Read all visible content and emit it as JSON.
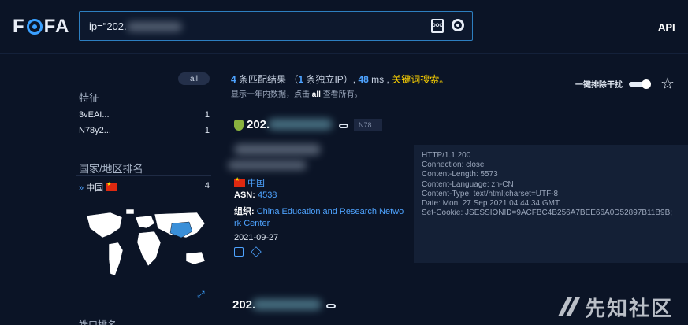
{
  "header": {
    "logo": "FOFA",
    "search_value": "ip=\"202.",
    "api_label": "API"
  },
  "sidebar": {
    "all_label": "all",
    "feature_title": "特征",
    "features": [
      {
        "label": "3vEAI...",
        "count": "1"
      },
      {
        "label": "N78y2...",
        "count": "1"
      }
    ],
    "country_title": "国家/地区排名",
    "countries": [
      {
        "label": "中国",
        "count": "4"
      }
    ],
    "bottom_title": "端口排名"
  },
  "results": {
    "count": "4",
    "count_suffix": "条匹配结果",
    "unique_prefix": "（",
    "unique_count": "1",
    "unique_suffix": "条独立IP）,",
    "time": "48",
    "time_unit": "ms ,",
    "keyword_search": "关键词搜索。",
    "sub_prefix": "显示一年内数据，点击",
    "sub_all": "all",
    "sub_suffix": "查看所有。",
    "toggle_label": "一键排除干扰",
    "items": [
      {
        "ip": "202.",
        "tag": "N78...",
        "country": "中国",
        "asn_label": "ASN:",
        "asn": "4538",
        "org_label": "组织:",
        "org_line1": "China Education and Research Netwo",
        "org_line2": "rk Center",
        "date": "2021-09-27",
        "http": [
          "HTTP/1.1 200",
          "Connection: close",
          "Content-Length: 5573",
          "Content-Language: zh-CN",
          "Content-Type: text/html;charset=UTF-8",
          "Date: Mon, 27 Sep 2021 04:44:34 GMT",
          "Set-Cookie: JSESSIONID=9ACFBC4B256A7BEE66A0D52897B11B9B;"
        ]
      },
      {
        "ip": "202."
      }
    ]
  },
  "watermark": "先知社区",
  "colors": {
    "background": "#0b1426",
    "accent": "#4ea3ff",
    "highlight": "#ffd400"
  }
}
